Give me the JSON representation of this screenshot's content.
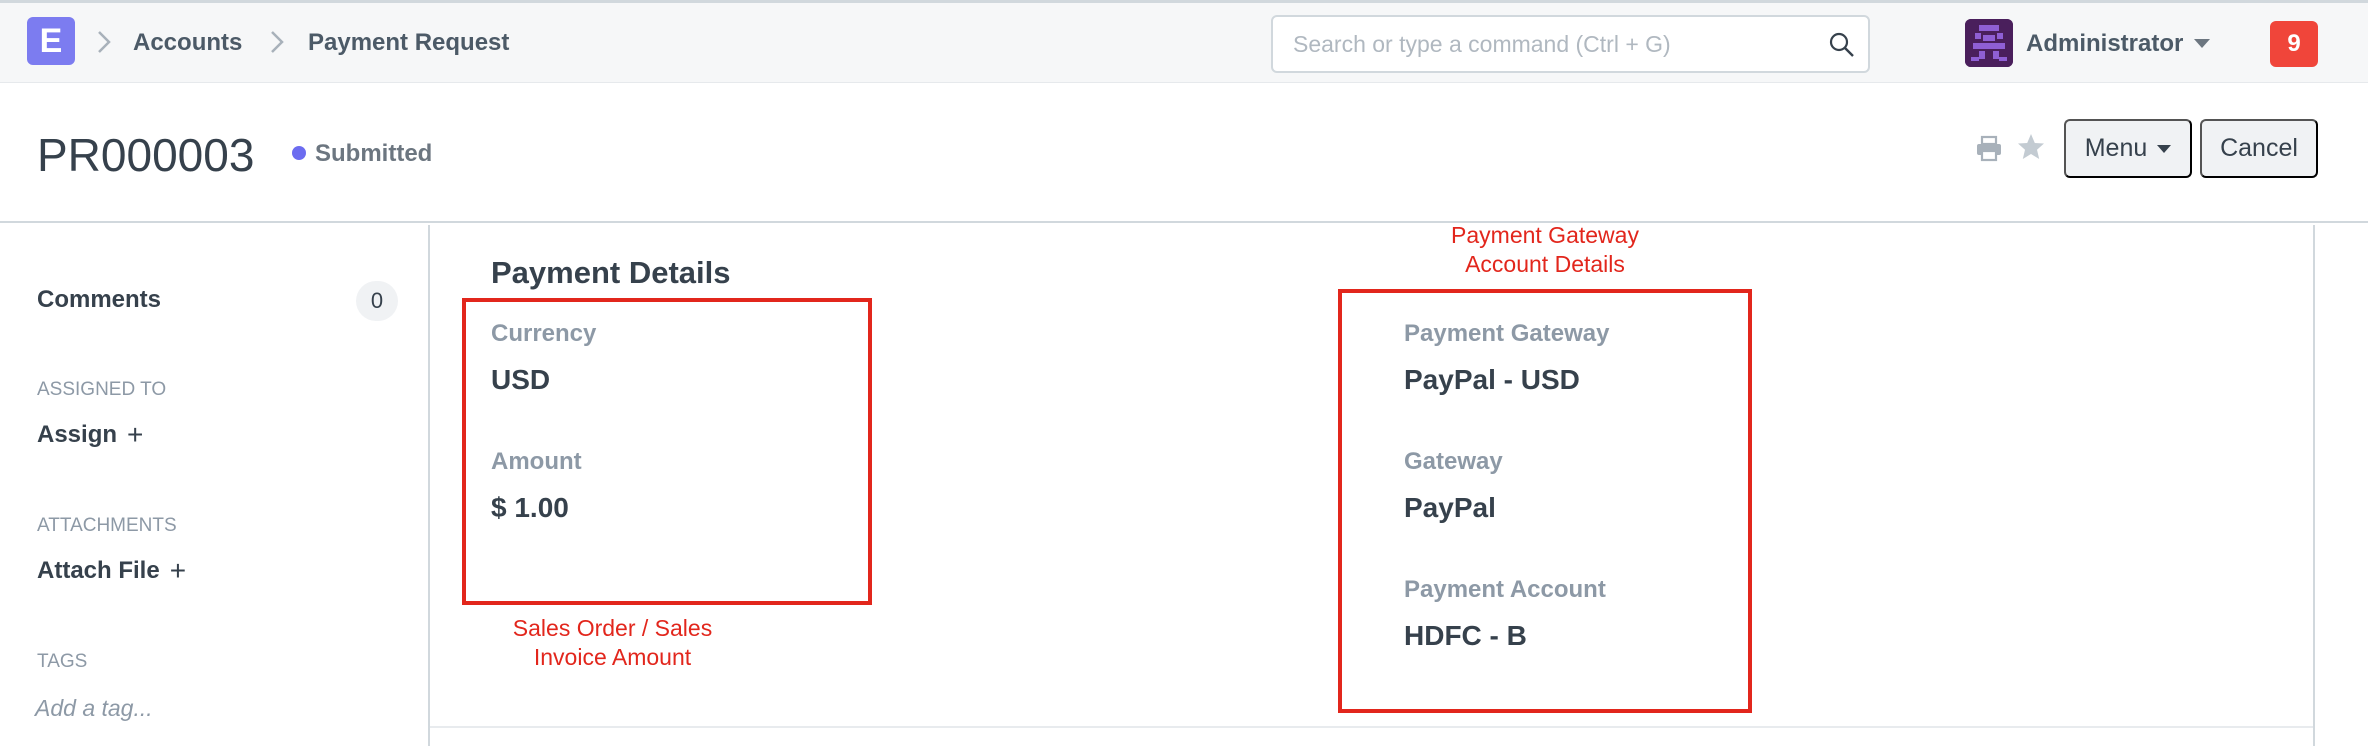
{
  "navbar": {
    "logo_letter": "E",
    "breadcrumbs": [
      "Accounts",
      "Payment Request"
    ],
    "search_placeholder": "Search or type a command (Ctrl + G)",
    "user_name": "Administrator",
    "notification_count": "9"
  },
  "page_head": {
    "title": "PR000003",
    "status": "Submitted",
    "status_color": "#6c6cf0",
    "menu_label": "Menu",
    "cancel_label": "Cancel"
  },
  "sidebar": {
    "comments_label": "Comments",
    "comments_count": "0",
    "assigned_to_label": "ASSIGNED TO",
    "assign_label": "Assign",
    "attachments_label": "ATTACHMENTS",
    "attach_file_label": "Attach File",
    "tags_label": "TAGS",
    "add_tag_placeholder": "Add a tag..."
  },
  "main": {
    "section_title": "Payment Details",
    "left_fields": [
      {
        "label": "Currency",
        "value": "USD"
      },
      {
        "label": "Amount",
        "value": "$ 1.00"
      }
    ],
    "right_fields": [
      {
        "label": "Payment Gateway",
        "value": "PayPal - USD"
      },
      {
        "label": "Gateway",
        "value": "PayPal"
      },
      {
        "label": "Payment Account",
        "value": "HDFC - B"
      }
    ]
  },
  "annotations": {
    "color": "#e2261c",
    "left_caption_line1": "Sales Order / Sales",
    "left_caption_line2": "Invoice Amount",
    "right_caption_line1": "Payment Gateway",
    "right_caption_line2": "Account Details"
  }
}
